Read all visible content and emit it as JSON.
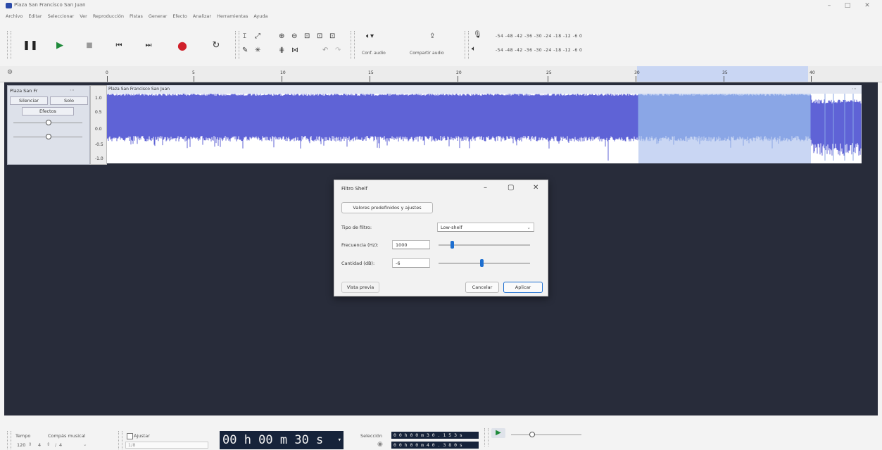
{
  "window": {
    "title": "Plaza San Francisco San Juan",
    "minimize": "–",
    "maximize": "□",
    "close": "✕"
  },
  "menu": [
    "Archivo",
    "Editar",
    "Seleccionar",
    "Ver",
    "Reproducción",
    "Pistas",
    "Generar",
    "Efecto",
    "Analizar",
    "Herramientas",
    "Ayuda"
  ],
  "toolbar": {
    "config_audio_label": "Conf. audio",
    "share_audio_label": "Compartir audio",
    "meter_scale": "-54 -48 -42 -36 -30 -24 -18 -12 -6 0"
  },
  "ruler": {
    "ticks": [
      "0",
      "5",
      "10",
      "15",
      "20",
      "25",
      "30",
      "35",
      "40"
    ]
  },
  "track": {
    "name": "Plaza San Fr",
    "mute_label": "Silenciar",
    "solo_label": "Solo",
    "effects_label": "Efectos",
    "clip_title": "Plaza San Francisco San Juan",
    "scale": [
      "1.0",
      "0.5",
      "0.0",
      "-0.5",
      "-1.0"
    ]
  },
  "dialog": {
    "title": "Filtro Shelf",
    "presets_button": "Valores predefinidos y ajustes",
    "filter_type_label": "Tipo de filtro:",
    "filter_type_value": "Low-shelf",
    "frequency_label": "Frecuencia (Hz):",
    "frequency_value": "1000",
    "frequency_slider": 0.13,
    "gain_label": "Cantidad (dB):",
    "gain_value": "-6",
    "gain_slider": 0.45,
    "preview_button": "Vista previa",
    "cancel_button": "Cancelar",
    "apply_button": "Aplicar"
  },
  "bottom": {
    "tempo_label": "Tempo",
    "tempo_value": "120",
    "signature_label": "Compás musical",
    "signature_num": "4",
    "signature_den": "4",
    "snap_label": "Ajustar",
    "snap_value": "1/8",
    "time_display": "00 h 00 m 30 s",
    "selection_label": "Selección",
    "selection_start": "0 0 h 0 0 m 3 0 . 1 5 3 s",
    "selection_end": "0 0 h 0 0 m 4 0 . 3 8 0 s"
  },
  "colors": {
    "waveform": "#5f63d6",
    "waveform_selected": "#8aa6e6",
    "selection": "#c9d6f3",
    "workspace": "#282c3a",
    "accent": "#1e6fd0"
  }
}
